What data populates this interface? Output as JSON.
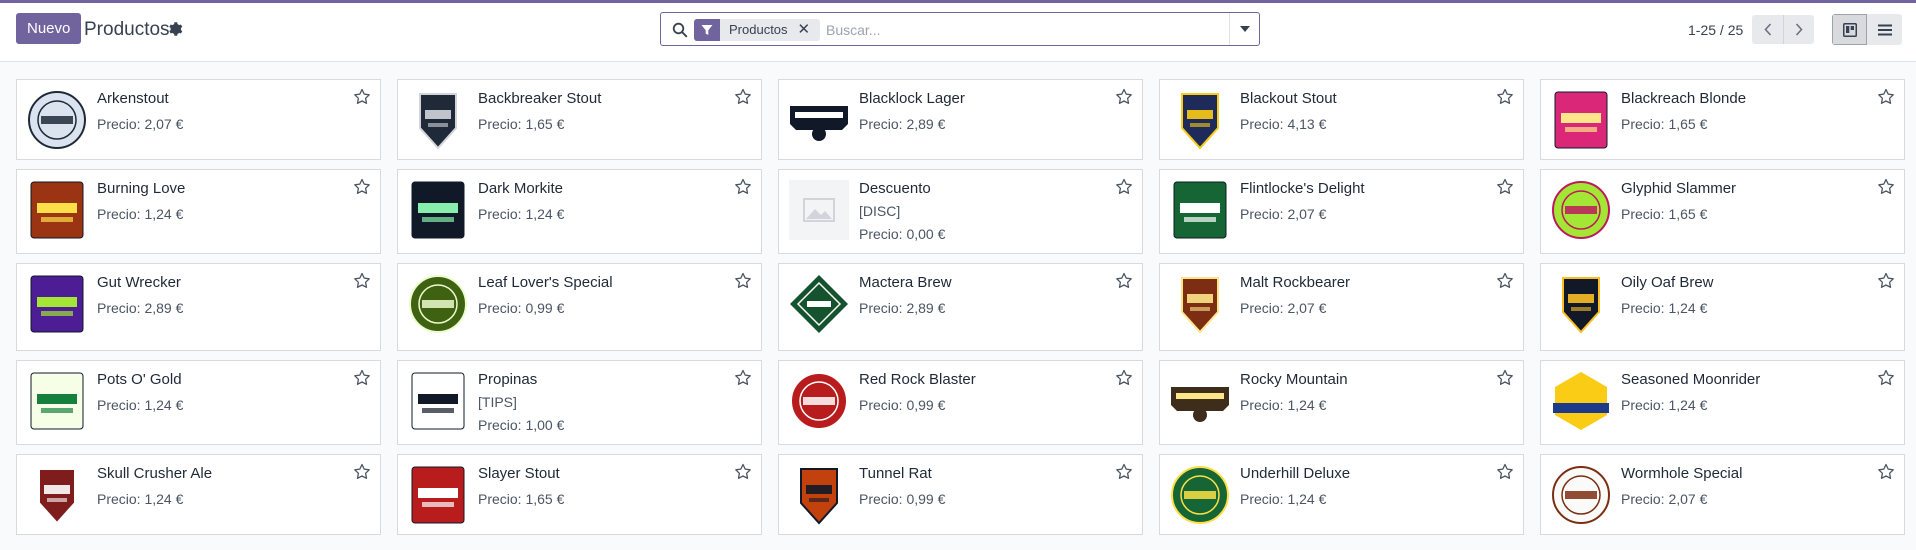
{
  "header": {
    "new_button": "Nuevo",
    "title": "Productos",
    "settings_icon": "gear-icon"
  },
  "search": {
    "facet_label": "Productos",
    "facet_icon": "filter-icon",
    "facet_remove": "✕",
    "placeholder": "Buscar..."
  },
  "pager": {
    "value": "1-25 / 25"
  },
  "views": {
    "active": "kanban",
    "items": [
      "kanban",
      "list"
    ]
  },
  "colors": {
    "accent": "#71639e"
  },
  "products": [
    {
      "name": "Arkenstout",
      "price": "Precio: 2,07 €"
    },
    {
      "name": "Backbreaker Stout",
      "price": "Precio: 1,65 €"
    },
    {
      "name": "Blacklock Lager",
      "price": "Precio: 2,89 €"
    },
    {
      "name": "Blackout Stout",
      "price": "Precio: 4,13 €"
    },
    {
      "name": "Blackreach Blonde",
      "price": "Precio: 1,65 €"
    },
    {
      "name": "Burning Love",
      "price": "Precio: 1,24 €"
    },
    {
      "name": "Dark Morkite",
      "price": "Precio: 1,24 €"
    },
    {
      "name": "Descuento",
      "code": "[DISC]",
      "price": "Precio: 0,00 €"
    },
    {
      "name": "Flintlocke's Delight",
      "price": "Precio: 2,07 €"
    },
    {
      "name": "Glyphid Slammer",
      "price": "Precio: 1,65 €"
    },
    {
      "name": "Gut Wrecker",
      "price": "Precio: 2,89 €"
    },
    {
      "name": "Leaf Lover's Special",
      "price": "Precio: 0,99 €"
    },
    {
      "name": "Mactera Brew",
      "price": "Precio: 2,89 €"
    },
    {
      "name": "Malt Rockbearer",
      "price": "Precio: 2,07 €"
    },
    {
      "name": "Oily Oaf Brew",
      "price": "Precio: 1,24 €"
    },
    {
      "name": "Pots O' Gold",
      "price": "Precio: 1,24 €"
    },
    {
      "name": "Propinas",
      "code": "[TIPS]",
      "price": "Precio: 1,00 €"
    },
    {
      "name": "Red Rock Blaster",
      "price": "Precio: 0,99 €"
    },
    {
      "name": "Rocky Mountain",
      "price": "Precio: 1,24 €"
    },
    {
      "name": "Seasoned Moonrider",
      "price": "Precio: 1,24 €"
    },
    {
      "name": "Skull Crusher Ale",
      "price": "Precio: 1,24 €"
    },
    {
      "name": "Slayer Stout",
      "price": "Precio: 1,65 €"
    },
    {
      "name": "Tunnel Rat",
      "price": "Precio: 0,99 €"
    },
    {
      "name": "Underhill Deluxe",
      "price": "Precio: 1,24 €"
    },
    {
      "name": "Wormhole Special",
      "price": "Precio: 2,07 €"
    }
  ]
}
